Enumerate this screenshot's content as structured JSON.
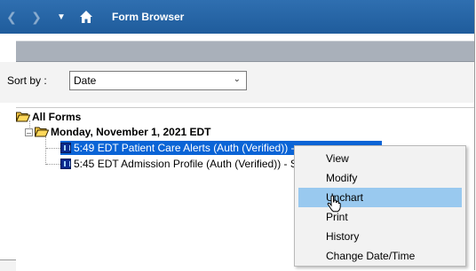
{
  "titlebar": {
    "title": "Form Browser",
    "icons": [
      "chevron-left-icon",
      "chevron-right-icon",
      "dropdown-arrow-icon",
      "home-icon"
    ]
  },
  "sort": {
    "label": "Sort by :",
    "value": "Date"
  },
  "tree": {
    "root_label": "All Forms",
    "date_label": "Monday, November 1, 2021 EDT",
    "items": [
      {
        "label": "5:49 EDT Patient Care Alerts (Auth (Verified)) -",
        "selected": true
      },
      {
        "label": "5:45 EDT Admission Profile (Auth (Verified)) - S",
        "selected": false
      }
    ]
  },
  "context_menu": {
    "items": [
      "View",
      "Modify",
      "Unchart",
      "Print",
      "History",
      "Change Date/Time"
    ],
    "highlighted": "Unchart"
  },
  "colors": {
    "titlebar": "#2466a8",
    "selection": "#0a64d6",
    "menu_highlight": "#99c9ef"
  }
}
